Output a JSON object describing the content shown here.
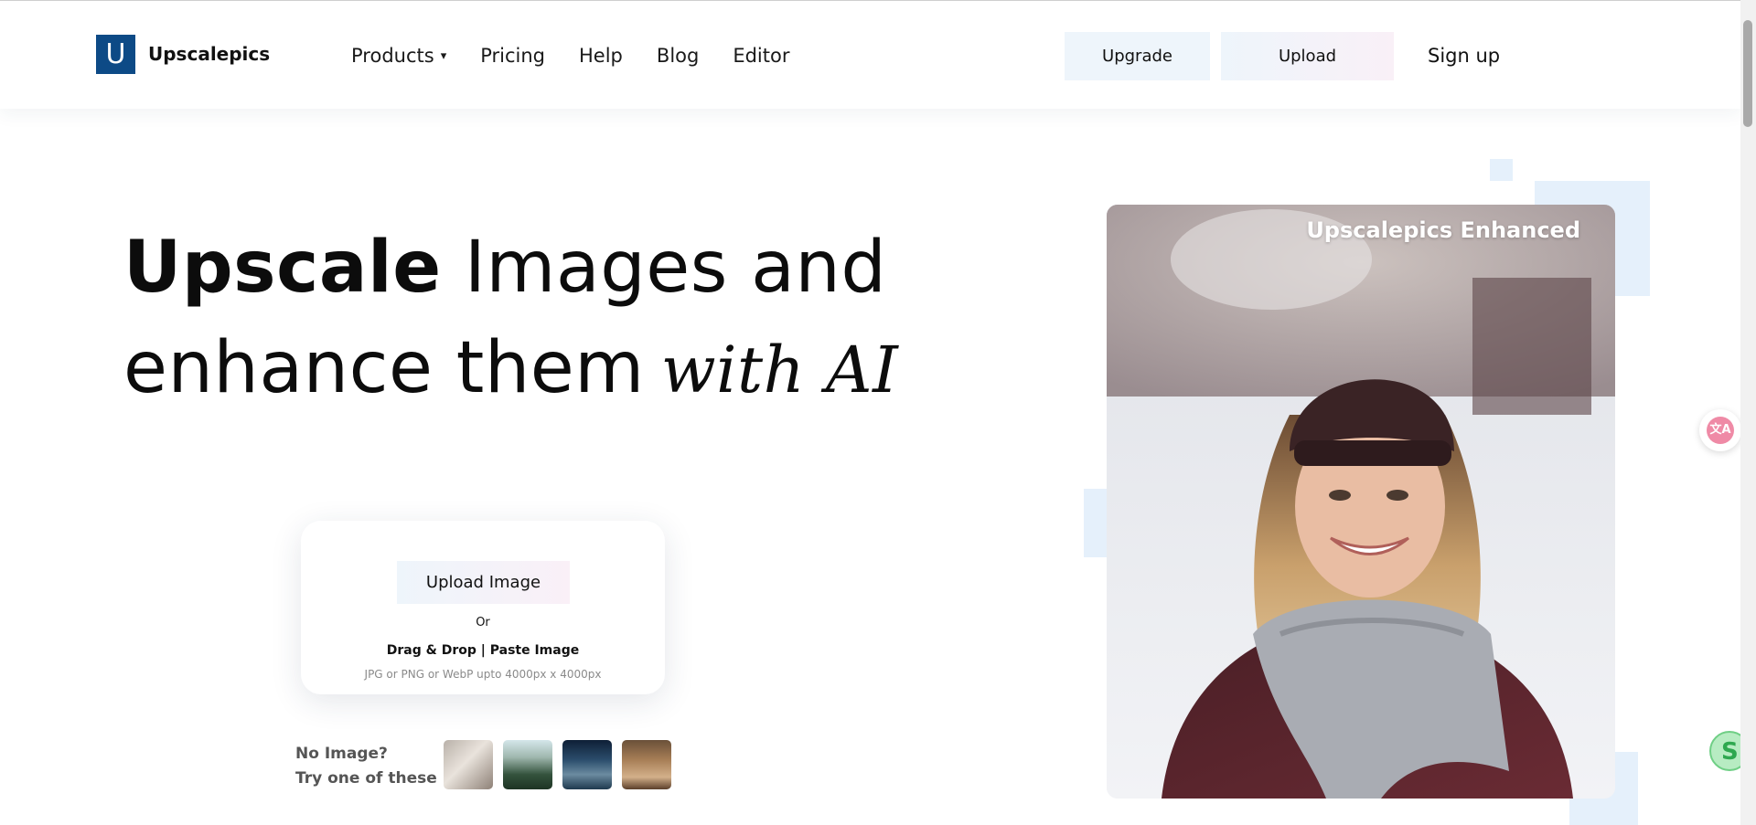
{
  "header": {
    "logo_letter": "U",
    "brand": "Upscalepics",
    "nav": [
      {
        "label": "Products",
        "caret": "▾"
      },
      {
        "label": "Pricing"
      },
      {
        "label": "Help"
      },
      {
        "label": "Blog"
      },
      {
        "label": "Editor"
      }
    ],
    "upgrade_label": "Upgrade",
    "upload_label": "Upload",
    "signup_label": "Sign up"
  },
  "hero": {
    "headline_strong": "Upscale",
    "headline_rest": "Images and",
    "headline_line2": "enhance them",
    "headline_script": "with AI"
  },
  "upload_card": {
    "button_label": "Upload Image",
    "or_text": "Or",
    "drag_text": "Drag & Drop | Paste Image",
    "format_text": "JPG or PNG or WebP upto 4000px x 4000px"
  },
  "samples": {
    "label_line1": "No Image?",
    "label_line2": "Try one of these :"
  },
  "photo": {
    "caption": "Upscalepics Enhanced"
  },
  "colors": {
    "brand_blue": "#0d4a86",
    "accent_light": "#e5f0fb"
  }
}
